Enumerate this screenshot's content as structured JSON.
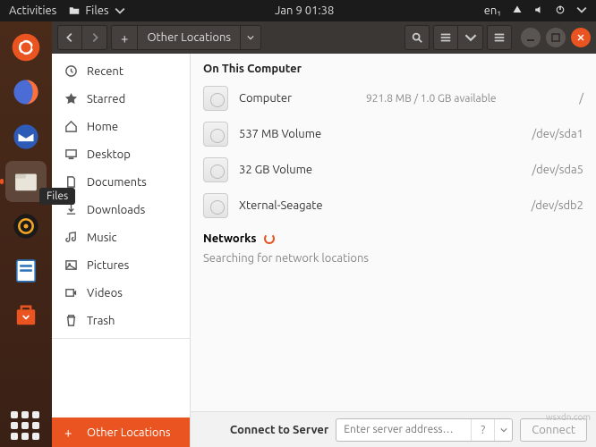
{
  "top_panel": {
    "activities": "Activities",
    "app_label": "Files",
    "clock": "Jan 9  01:38",
    "lang": "en₁"
  },
  "dock": {
    "tooltip": "Files"
  },
  "headerbar": {
    "location": "Other Locations"
  },
  "sidebar": {
    "items": [
      {
        "label": "Recent"
      },
      {
        "label": "Starred"
      },
      {
        "label": "Home"
      },
      {
        "label": "Desktop"
      },
      {
        "label": "Documents"
      },
      {
        "label": "Downloads"
      },
      {
        "label": "Music"
      },
      {
        "label": "Pictures"
      },
      {
        "label": "Videos"
      },
      {
        "label": "Trash"
      }
    ],
    "other_locations": "Other Locations"
  },
  "content": {
    "section_computer": "On This Computer",
    "devices": [
      {
        "name": "Computer",
        "free": "921.8 MB / 1.0 GB available",
        "path": "/"
      },
      {
        "name": "537 MB Volume",
        "free": "",
        "path": "/dev/sda1"
      },
      {
        "name": "32 GB Volume",
        "free": "",
        "path": "/dev/sda5"
      },
      {
        "name": "Xternal-Seagate",
        "free": "",
        "path": "/dev/sdb2"
      }
    ],
    "section_networks": "Networks",
    "network_status": "Searching for network locations"
  },
  "footer": {
    "label": "Connect to Server",
    "placeholder": "Enter server address…",
    "connect": "Connect"
  },
  "watermark": "wsxdn.com"
}
